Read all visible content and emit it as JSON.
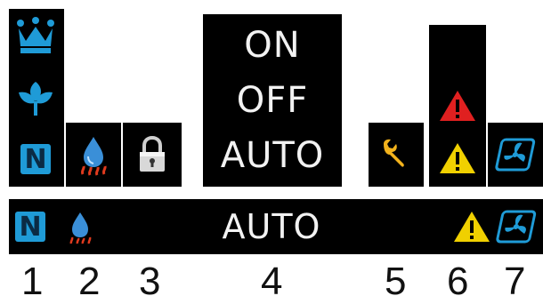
{
  "panel": {
    "mode_on": "ON",
    "mode_off": "OFF",
    "mode_auto": "AUTO",
    "n_letter": "N"
  },
  "bar": {
    "mode_text": "AUTO",
    "n_letter": "N"
  },
  "numbers": [
    "1",
    "2",
    "3",
    "4",
    "5",
    "6",
    "7"
  ],
  "colors": {
    "background": "#000000",
    "icon_blue": "#1f9bd7",
    "warning_red": "#e02020",
    "warning_yellow": "#f0d000",
    "wrench_yellow": "#f2b21c",
    "flame_red": "#e03a1e"
  },
  "icons": [
    "crown-icon",
    "leaf-icon",
    "n-mode-icon",
    "water-heat-icon",
    "lock-icon",
    "wrench-icon",
    "warning-red-icon",
    "warning-yellow-icon",
    "fan-icon"
  ]
}
